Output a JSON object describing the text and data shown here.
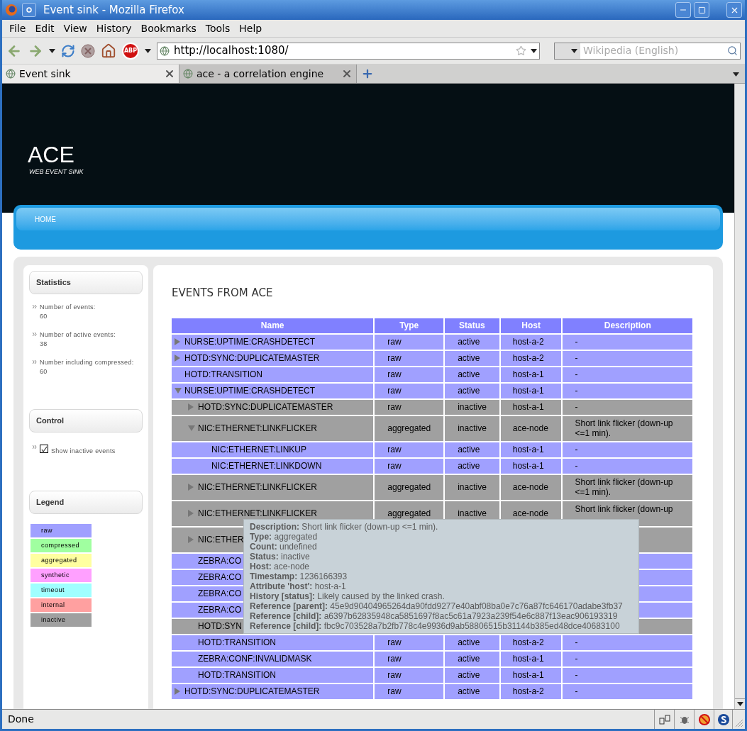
{
  "window": {
    "title": "Event sink - Mozilla Firefox"
  },
  "menu": [
    "File",
    "Edit",
    "View",
    "History",
    "Bookmarks",
    "Tools",
    "Help"
  ],
  "toolbar": {
    "adblock_label": "ABP",
    "url": "http://localhost:1080/",
    "search_placeholder": "Wikipedia (English)"
  },
  "tabs": [
    {
      "label": "Event sink",
      "selected": true
    },
    {
      "label": "ace - a correlation engine",
      "selected": false
    }
  ],
  "site": {
    "title": "ACE",
    "subtitle": "WEB EVENT SINK",
    "nav": [
      "HOME"
    ]
  },
  "sidebar": {
    "statistics": {
      "title": "Statistics",
      "items": [
        {
          "label": "Number of events:",
          "value": "60"
        },
        {
          "label": "Number of active events:",
          "value": "38"
        },
        {
          "label": "Number including compressed:",
          "value": "60"
        }
      ]
    },
    "control": {
      "title": "Control",
      "options": [
        {
          "label": "Show inactive events",
          "checked": true
        }
      ]
    },
    "legend": {
      "title": "Legend",
      "items": [
        {
          "label": "raw",
          "color": "#a0a0ff"
        },
        {
          "label": "compressed",
          "color": "#a0ffa0"
        },
        {
          "label": "aggregated",
          "color": "#ffffa0"
        },
        {
          "label": "synthetic",
          "color": "#ffa0ff"
        },
        {
          "label": "timeout",
          "color": "#a0ffff"
        },
        {
          "label": "internal",
          "color": "#ffa0a0"
        },
        {
          "label": "inactive",
          "color": "#a0a0a0"
        }
      ]
    }
  },
  "main": {
    "title": "EVENTS FROM ACE",
    "table": {
      "columns": [
        "Name",
        "Type",
        "Status",
        "Host",
        "Description"
      ],
      "rows": [
        {
          "name": "NURSE:UPTIME:CRASHDETECT",
          "type": "raw",
          "status": "active",
          "host": "host-a-2",
          "description": "-",
          "color": "#a0a0ff",
          "expanded": false
        },
        {
          "name": "HOTD:SYNC:DUPLICATEMASTER",
          "type": "raw",
          "status": "active",
          "host": "host-a-2",
          "description": "-",
          "color": "#a0a0ff",
          "expanded": false
        },
        {
          "name": "HOTD:TRANSITION",
          "type": "raw",
          "status": "active",
          "host": "host-a-1",
          "description": "-",
          "color": "#a0a0ff"
        },
        {
          "name": "NURSE:UPTIME:CRASHDETECT",
          "type": "raw",
          "status": "active",
          "host": "host-a-1",
          "description": "-",
          "color": "#a0a0ff",
          "expanded": true,
          "children": [
            {
              "name": "HOTD:SYNC:DUPLICATEMASTER",
              "type": "raw",
              "status": "inactive",
              "host": "host-a-1",
              "description": "-",
              "color": "#a0a0a0",
              "expanded": false
            },
            {
              "name": "NIC:ETHERNET:LINKFLICKER",
              "type": "aggregated",
              "status": "inactive",
              "host": "ace-node",
              "description": "Short link flicker (down-up <=1 min).",
              "color": "#a0a0a0",
              "expanded": true,
              "children": [
                {
                  "name": "NIC:ETHERNET:LINKUP",
                  "type": "raw",
                  "status": "active",
                  "host": "host-a-1",
                  "description": "-",
                  "color": "#a0a0ff"
                },
                {
                  "name": "NIC:ETHERNET:LINKDOWN",
                  "type": "raw",
                  "status": "active",
                  "host": "host-a-1",
                  "description": "-",
                  "color": "#a0a0ff"
                }
              ]
            },
            {
              "name": "NIC:ETHERNET:LINKFLICKER",
              "type": "aggregated",
              "status": "inactive",
              "host": "ace-node",
              "description": "Short link flicker (down-up <=1 min).",
              "color": "#a0a0a0",
              "expanded": false
            },
            {
              "name": "NIC:ETHERNET:LINKFLICKER",
              "type": "aggregated",
              "status": "inactive",
              "host": "ace-node",
              "description": "Short link flicker (down-up",
              "color": "#a0a0a0",
              "expanded": false,
              "tall": true
            },
            {
              "name": "NIC:ETHER",
              "color": "#a0a0a0",
              "expanded": false,
              "tall": true
            },
            {
              "name": "ZEBRA:CO",
              "color": "#a0a0ff"
            },
            {
              "name": "ZEBRA:CO",
              "color": "#a0a0ff"
            },
            {
              "name": "ZEBRA:CO",
              "color": "#a0a0ff"
            },
            {
              "name": "ZEBRA:CO",
              "color": "#a0a0ff"
            },
            {
              "name": "HOTD:SYN",
              "color": "#a0a0a0"
            },
            {
              "name": "HOTD:TRANSITION",
              "type": "raw",
              "status": "active",
              "host": "host-a-2",
              "description": "-",
              "color": "#a0a0ff"
            },
            {
              "name": "ZEBRA:CONF:INVALIDMASK",
              "type": "raw",
              "status": "active",
              "host": "host-a-1",
              "description": "-",
              "color": "#a0a0ff"
            },
            {
              "name": "HOTD:TRANSITION",
              "type": "raw",
              "status": "active",
              "host": "host-a-1",
              "description": "-",
              "color": "#a0a0ff"
            }
          ]
        },
        {
          "name": "HOTD:SYNC:DUPLICATEMASTER",
          "type": "raw",
          "status": "active",
          "host": "host-a-2",
          "description": "-",
          "color": "#a0a0ff",
          "expanded": false
        }
      ]
    },
    "tooltip": [
      "**Description:** Short link flicker (down-up <=1 min).",
      "**Type:** aggregated",
      "**Count:** undefined",
      "**Status:** inactive",
      "**Host:** ace-node",
      "**Timestamp:** 1236166393",
      "**Attribute 'host':** host-a-1",
      "**History [status]:** Likely caused by the linked crash.",
      "**Reference [parent]:** 45e9d90404965264da90fdd9277e40abf08ba0e7c76a87fc646170adabe3fb37",
      "**Reference [child]:** a6397b62835948ca5851697f8ac5c61a7923a239f54e6c887f13eac906193319",
      "**Reference [child]:** fbc9c703528a7b2fb778c4e9936d9ab58806515b31144b385ed48dce40683100"
    ]
  },
  "status_bar": {
    "text": "Done"
  }
}
